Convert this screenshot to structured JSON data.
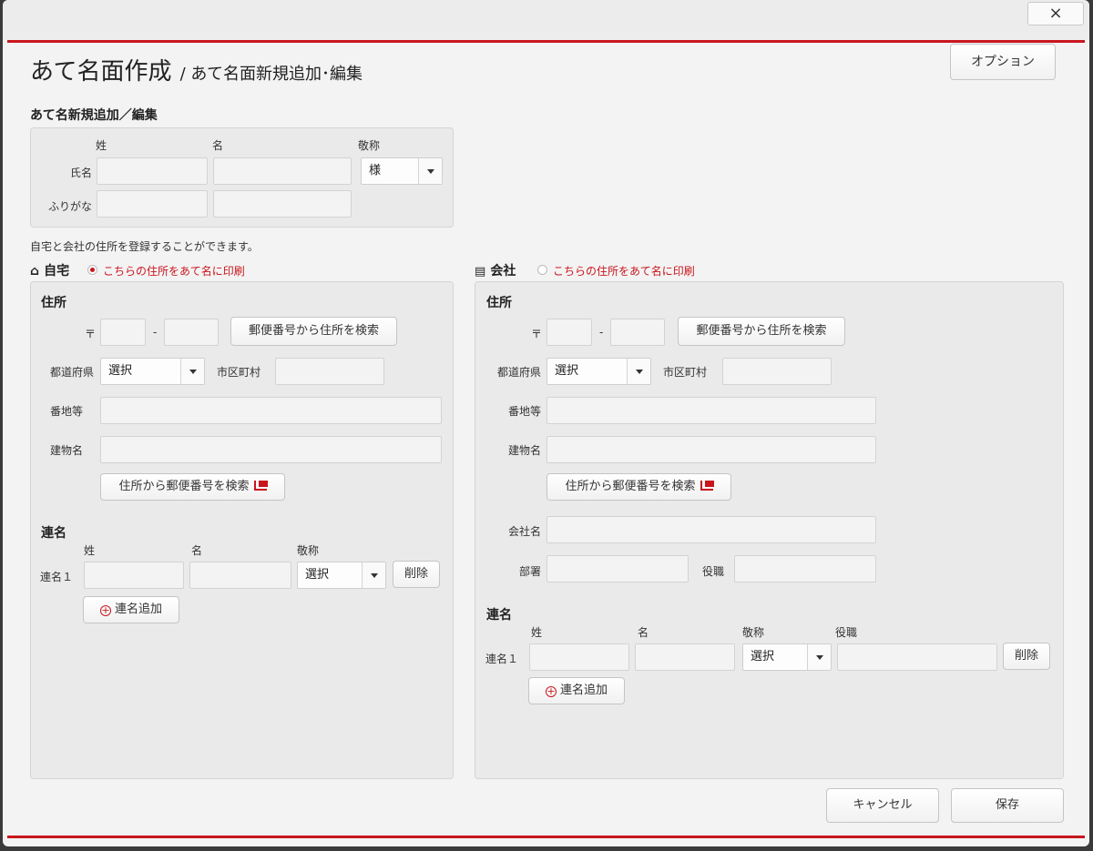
{
  "window": {
    "close_label": "×"
  },
  "header": {
    "title": "あて名面作成",
    "subtitle": "/ あて名面新規追加･編集",
    "option_button": "オプション"
  },
  "name_section": {
    "heading": "あて名新規追加／編集",
    "col_sei": "姓",
    "col_mei": "名",
    "col_keisho": "敬称",
    "row_name": "氏名",
    "row_furigana": "ふりがな",
    "keisho_value": "様"
  },
  "note": "自宅と会社の住所を登録することができます。",
  "home": {
    "title": "自宅",
    "radio_label": "こちらの住所をあて名に印刷",
    "radio_selected": true,
    "address_heading": "住所",
    "postal_mark": "〒",
    "postal_sep": "-",
    "search_by_postal": "郵便番号から住所を検索",
    "prefecture_label": "都道府県",
    "prefecture_value": "選択",
    "city_label": "市区町村",
    "banchi_label": "番地等",
    "building_label": "建物名",
    "search_by_address": "住所から郵便番号を検索",
    "renmei_heading": "連名",
    "col_sei": "姓",
    "col_mei": "名",
    "col_keisho": "敬称",
    "renmei_row": "連名１",
    "renmei_keisho_value": "選択",
    "delete_button": "削除",
    "add_button": "連名追加"
  },
  "company": {
    "title": "会社",
    "radio_label": "こちらの住所をあて名に印刷",
    "radio_selected": false,
    "address_heading": "住所",
    "postal_mark": "〒",
    "postal_sep": "-",
    "search_by_postal": "郵便番号から住所を検索",
    "prefecture_label": "都道府県",
    "prefecture_value": "選択",
    "city_label": "市区町村",
    "banchi_label": "番地等",
    "building_label": "建物名",
    "search_by_address": "住所から郵便番号を検索",
    "company_name_label": "会社名",
    "department_label": "部署",
    "position_label": "役職",
    "renmei_heading": "連名",
    "col_sei": "姓",
    "col_mei": "名",
    "col_keisho": "敬称",
    "col_position": "役職",
    "renmei_row": "連名１",
    "renmei_keisho_value": "選択",
    "delete_button": "削除",
    "add_button": "連名追加"
  },
  "footer": {
    "cancel": "キャンセル",
    "save": "保存"
  },
  "colors": {
    "accent": "#c8161d",
    "panel": "#eaeaea",
    "dialog": "#f3f3f3"
  }
}
